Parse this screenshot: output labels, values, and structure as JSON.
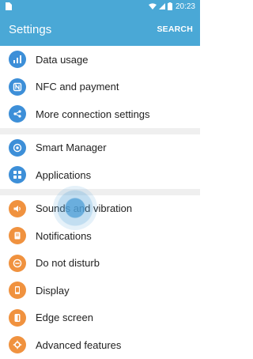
{
  "status_bar": {
    "time": "20:23"
  },
  "header": {
    "title": "Settings",
    "search_label": "SEARCH"
  },
  "colors": {
    "accent": "#4aa8d6",
    "blue_icon": "#3d8fd8",
    "orange_icon": "#f0923f"
  },
  "groups": [
    {
      "items": [
        {
          "label": "Data usage",
          "icon": "bar-chart-icon"
        },
        {
          "label": "NFC and payment",
          "icon": "nfc-icon"
        },
        {
          "label": "More connection settings",
          "icon": "connections-icon"
        }
      ]
    },
    {
      "items": [
        {
          "label": "Smart Manager",
          "icon": "smart-manager-icon"
        },
        {
          "label": "Applications",
          "icon": "apps-grid-icon"
        }
      ]
    },
    {
      "items": [
        {
          "label": "Sounds and vibration",
          "icon": "volume-icon"
        },
        {
          "label": "Notifications",
          "icon": "notification-icon"
        },
        {
          "label": "Do not disturb",
          "icon": "do-not-disturb-icon"
        },
        {
          "label": "Display",
          "icon": "display-icon"
        },
        {
          "label": "Edge screen",
          "icon": "edge-screen-icon"
        },
        {
          "label": "Advanced features",
          "icon": "advanced-features-icon"
        }
      ]
    }
  ]
}
